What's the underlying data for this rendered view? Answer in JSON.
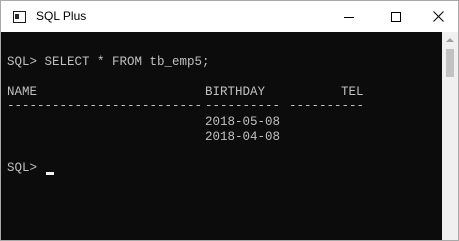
{
  "window": {
    "title": "SQL Plus",
    "icon": "console-app-icon",
    "controls": [
      "minimize-icon",
      "maximize-icon",
      "close-icon"
    ]
  },
  "console": {
    "command_line": "SQL> SELECT * FROM tb_emp5;",
    "columns": [
      "NAME",
      "BIRTHDAY",
      "TEL"
    ],
    "separators": [
      "--------------------------",
      "----------",
      "----------"
    ],
    "rows": [
      {
        "NAME": "",
        "BIRTHDAY": "2018-05-08",
        "TEL": ""
      },
      {
        "NAME": "",
        "BIRTHDAY": "2018-04-08",
        "TEL": ""
      }
    ],
    "prompt": "SQL>"
  },
  "colors": {
    "console_bg": "#0c0c0c",
    "console_text": "#c0c0c0",
    "titlebar_bg": "#ffffff"
  }
}
